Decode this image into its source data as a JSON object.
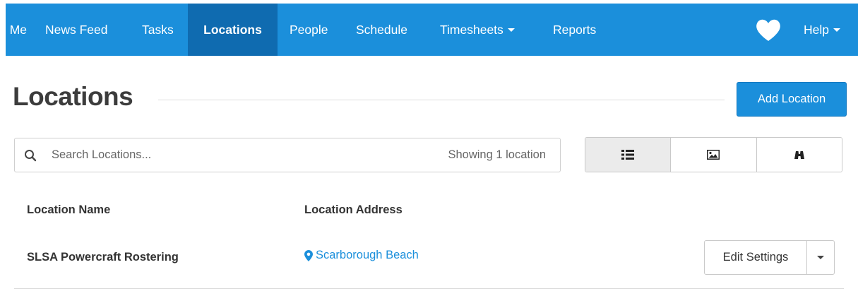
{
  "nav": {
    "items": [
      {
        "label": "Me"
      },
      {
        "label": "News Feed"
      },
      {
        "label": "Tasks"
      },
      {
        "label": "Locations"
      },
      {
        "label": "People"
      },
      {
        "label": "Schedule"
      },
      {
        "label": "Timesheets"
      },
      {
        "label": "Reports"
      }
    ],
    "help": "Help",
    "active": "Locations",
    "color": "#1b8fdb",
    "active_color": "#0f6bb0"
  },
  "header": {
    "title": "Locations",
    "add_button": "Add Location"
  },
  "search": {
    "placeholder": "Search Locations...",
    "count": "Showing 1 location"
  },
  "view_toggle": {
    "options": [
      "list-icon",
      "image-icon",
      "binoculars-icon"
    ],
    "active": "list-icon"
  },
  "table": {
    "columns": [
      "Location Name",
      "Location Address"
    ],
    "rows": [
      {
        "name": "SLSA Powercraft Rostering",
        "address": "Scarborough Beach",
        "action": "Edit Settings"
      }
    ]
  }
}
